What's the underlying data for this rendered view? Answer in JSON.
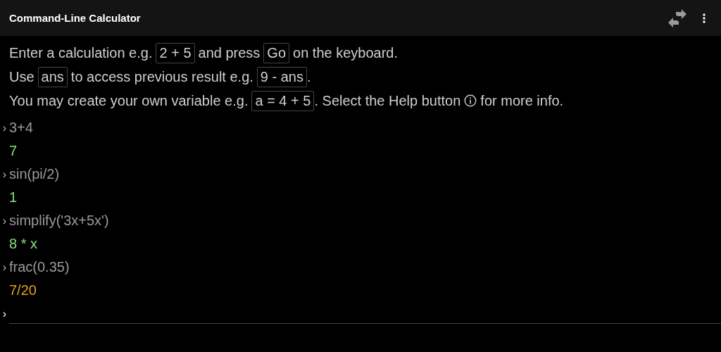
{
  "app_bar": {
    "title": "Command-Line Calculator"
  },
  "instructions": [
    [
      {
        "kind": "text",
        "text": "Enter a calculation e.g."
      },
      {
        "kind": "code",
        "text": "2 + 5"
      },
      {
        "kind": "text",
        "text": "and press"
      },
      {
        "kind": "code",
        "text": "Go"
      },
      {
        "kind": "text",
        "text": "on the keyboard."
      }
    ],
    [
      {
        "kind": "text",
        "text": "Use"
      },
      {
        "kind": "code",
        "text": "ans"
      },
      {
        "kind": "text",
        "text": "to access previous result e.g."
      },
      {
        "kind": "code",
        "text": "9 - ans"
      },
      {
        "kind": "text",
        "text": "."
      }
    ],
    [
      {
        "kind": "text",
        "text": "You may create your own variable e.g."
      },
      {
        "kind": "code",
        "text": "a = 4 + 5"
      },
      {
        "kind": "text",
        "text": ". Select the Help button"
      },
      {
        "kind": "icon"
      },
      {
        "kind": "text",
        "text": "for more info."
      }
    ]
  ],
  "history": [
    {
      "kind": "input",
      "prompt": "›",
      "text": "3+4"
    },
    {
      "kind": "result",
      "text": "7",
      "color": "#86e07f"
    },
    {
      "kind": "input",
      "prompt": "›",
      "text": "sin(pi/2)"
    },
    {
      "kind": "result",
      "text": "1",
      "color": "#86e07f"
    },
    {
      "kind": "input",
      "prompt": "›",
      "text": "simplify('3x+5x')"
    },
    {
      "kind": "result",
      "text": "8 * x",
      "color": "#86e07f"
    },
    {
      "kind": "input",
      "prompt": "›",
      "text": "frac(0.35)"
    },
    {
      "kind": "result",
      "text": "7/20",
      "color": "#e0a21c"
    }
  ],
  "input_line": {
    "prompt": "›"
  }
}
